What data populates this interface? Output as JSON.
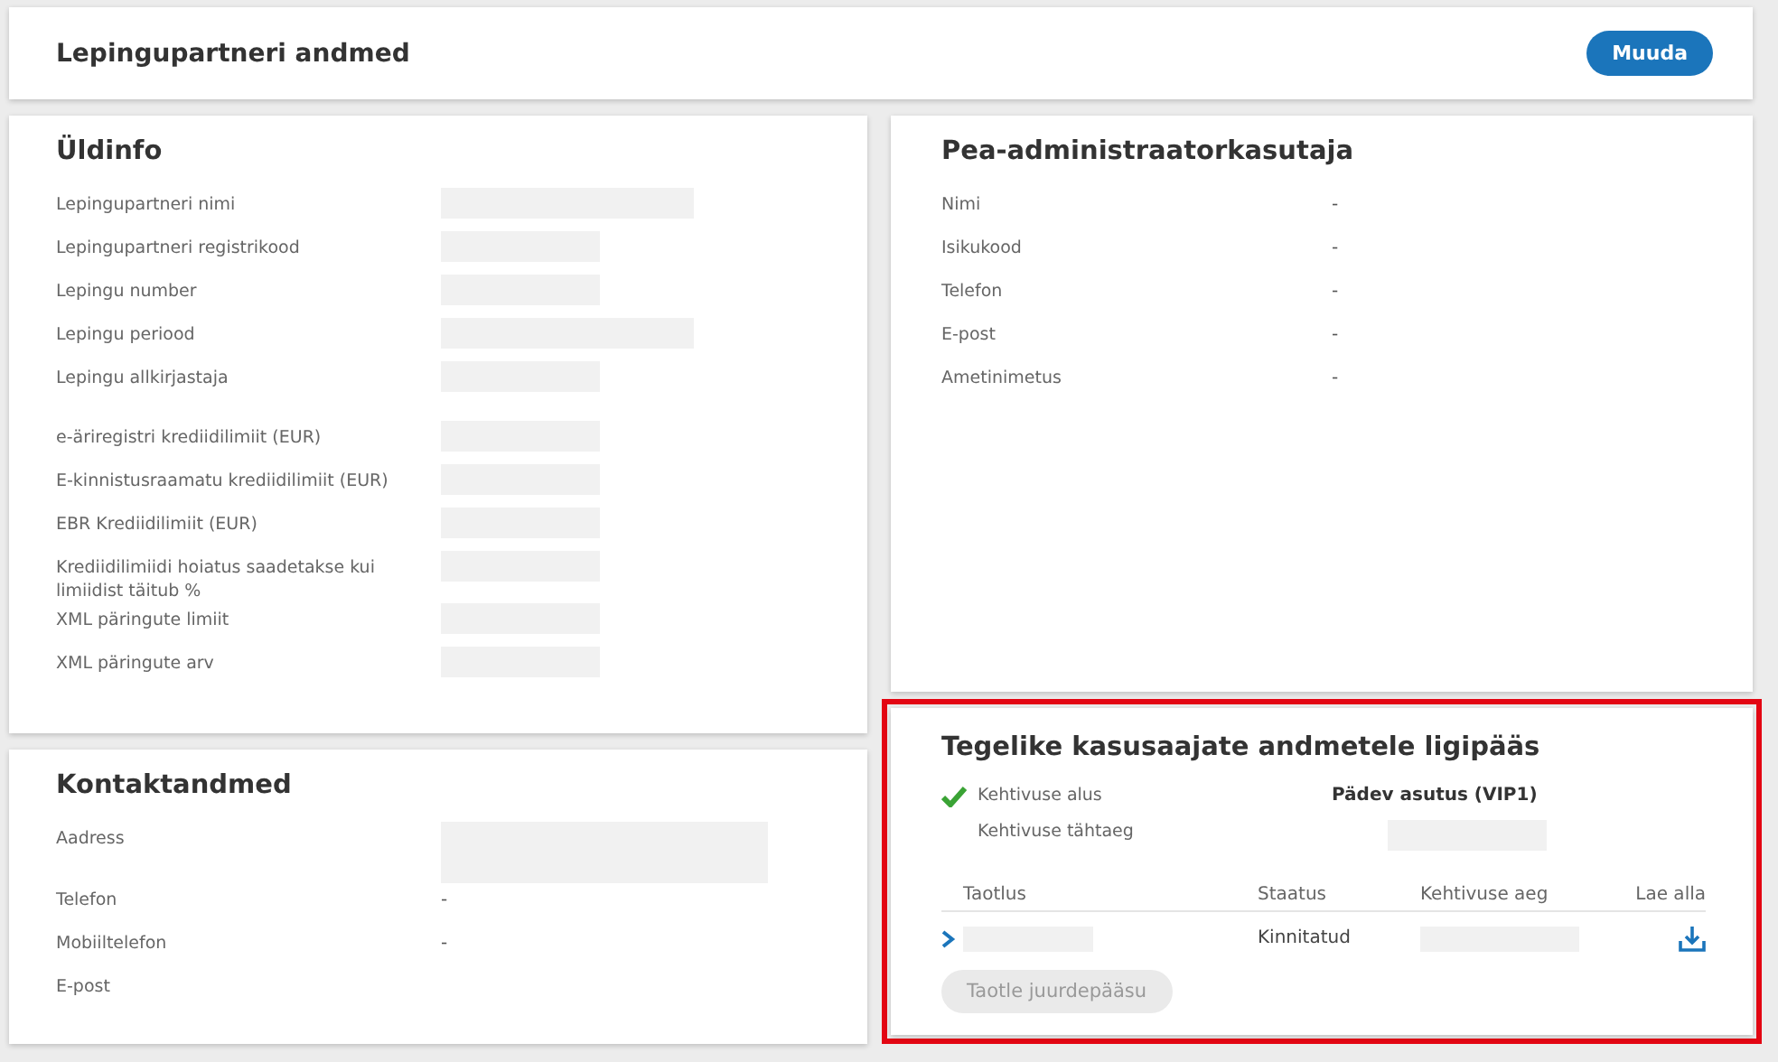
{
  "header": {
    "title": "Lepingupartneri andmed",
    "button": "Muuda"
  },
  "general": {
    "title": "Üldinfo",
    "fields": [
      {
        "label": "Lepingupartneri nimi",
        "kind": "redacted_wide"
      },
      {
        "label": "Lepingupartneri registrikood",
        "kind": "redacted"
      },
      {
        "label": "Lepingu number",
        "kind": "redacted"
      },
      {
        "label": "Lepingu periood",
        "kind": "redacted_wide"
      },
      {
        "label": "Lepingu allkirjastaja",
        "kind": "redacted"
      },
      {
        "label": "e-äriregistri krediidilimiit (EUR)",
        "kind": "redacted"
      },
      {
        "label": "E-kinnistusraamatu krediidilimiit (EUR)",
        "kind": "redacted"
      },
      {
        "label": "EBR Krediidilimiit (EUR)",
        "kind": "redacted"
      },
      {
        "label": "Krediidilimiidi hoiatus saadetakse kui limiidist täitub %",
        "kind": "redacted"
      },
      {
        "label": "XML päringute limiit",
        "kind": "redacted"
      },
      {
        "label": "XML päringute arv",
        "kind": "redacted"
      }
    ]
  },
  "contact": {
    "title": "Kontaktandmed",
    "fields": [
      {
        "label": "Aadress",
        "kind": "redacted_block"
      },
      {
        "label": "Telefon",
        "kind": "text",
        "value": "-"
      },
      {
        "label": "Mobiiltelefon",
        "kind": "text",
        "value": "-"
      },
      {
        "label": "E-post",
        "kind": "empty"
      }
    ]
  },
  "admin": {
    "title": "Pea-administraatorkasutaja",
    "fields": [
      {
        "label": "Nimi",
        "kind": "text",
        "value": "-"
      },
      {
        "label": "Isikukood",
        "kind": "text",
        "value": "-"
      },
      {
        "label": "Telefon",
        "kind": "text",
        "value": "-"
      },
      {
        "label": "E-post",
        "kind": "text",
        "value": "-"
      },
      {
        "label": "Ametinimetus",
        "kind": "text",
        "value": "-"
      }
    ]
  },
  "access": {
    "title": "Tegelike kasusaajate andmetele ligipääs",
    "highlighted": true,
    "basis": {
      "label": "Kehtivuse alus",
      "valid": true,
      "value": "Pädev asutus (VIP1)"
    },
    "expiry": {
      "label": "Kehtivuse tähtaeg",
      "kind": "redacted"
    },
    "table": {
      "columns": [
        "Taotlus",
        "Staatus",
        "Kehtivuse aeg",
        "Lae alla"
      ],
      "rows": [
        {
          "expanded": false,
          "status": "Kinnitatud"
        }
      ]
    },
    "button": {
      "label": "Taotle juurdepääsu",
      "disabled": true
    }
  }
}
